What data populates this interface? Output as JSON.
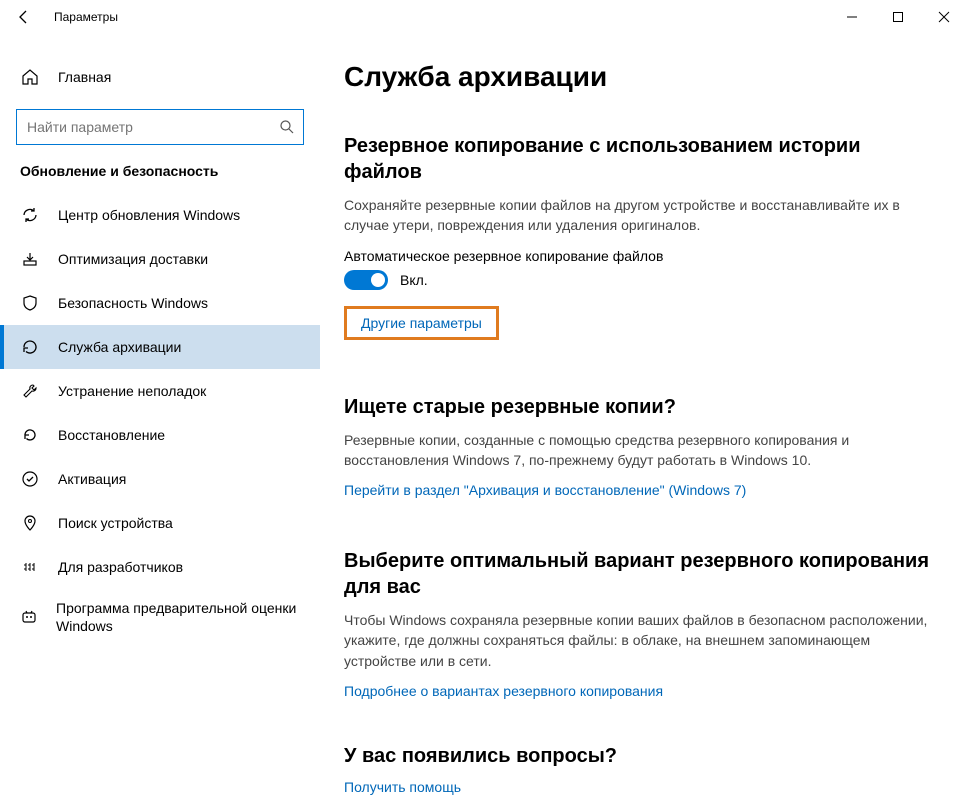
{
  "window": {
    "title": "Параметры"
  },
  "sidebar": {
    "home": "Главная",
    "search_placeholder": "Найти параметр",
    "section_title": "Обновление и безопасность",
    "items": [
      {
        "label": "Центр обновления Windows"
      },
      {
        "label": "Оптимизация доставки"
      },
      {
        "label": "Безопасность Windows"
      },
      {
        "label": "Служба архивации"
      },
      {
        "label": "Устранение неполадок"
      },
      {
        "label": "Восстановление"
      },
      {
        "label": "Активация"
      },
      {
        "label": "Поиск устройства"
      },
      {
        "label": "Для разработчиков"
      },
      {
        "label": "Программа предварительной оценки Windows"
      }
    ]
  },
  "main": {
    "page_title": "Служба архивации",
    "s1": {
      "heading": "Резервное копирование с использованием истории файлов",
      "desc": "Сохраняйте резервные копии файлов на другом устройстве и восстанавливайте их в случае утери, повреждения или удаления оригиналов.",
      "toggle_label": "Автоматическое резервное копирование файлов",
      "toggle_state": "Вкл.",
      "more_link": "Другие параметры"
    },
    "s2": {
      "heading": "Ищете старые резервные копии?",
      "desc": "Резервные копии, созданные с помощью средства резервного копирования и восстановления Windows 7, по-прежнему будут работать в Windows 10.",
      "link": "Перейти в раздел \"Архивация и восстановление\" (Windows 7)"
    },
    "s3": {
      "heading": "Выберите оптимальный вариант резервного копирования для вас",
      "desc": "Чтобы Windows сохраняла резервные копии ваших файлов в безопасном расположении, укажите, где должны сохраняться файлы: в облаке, на внешнем запоминающем устройстве или в сети.",
      "link": "Подробнее о вариантах резервного копирования"
    },
    "s4": {
      "heading": "У вас появились вопросы?",
      "link": "Получить помощь"
    }
  }
}
